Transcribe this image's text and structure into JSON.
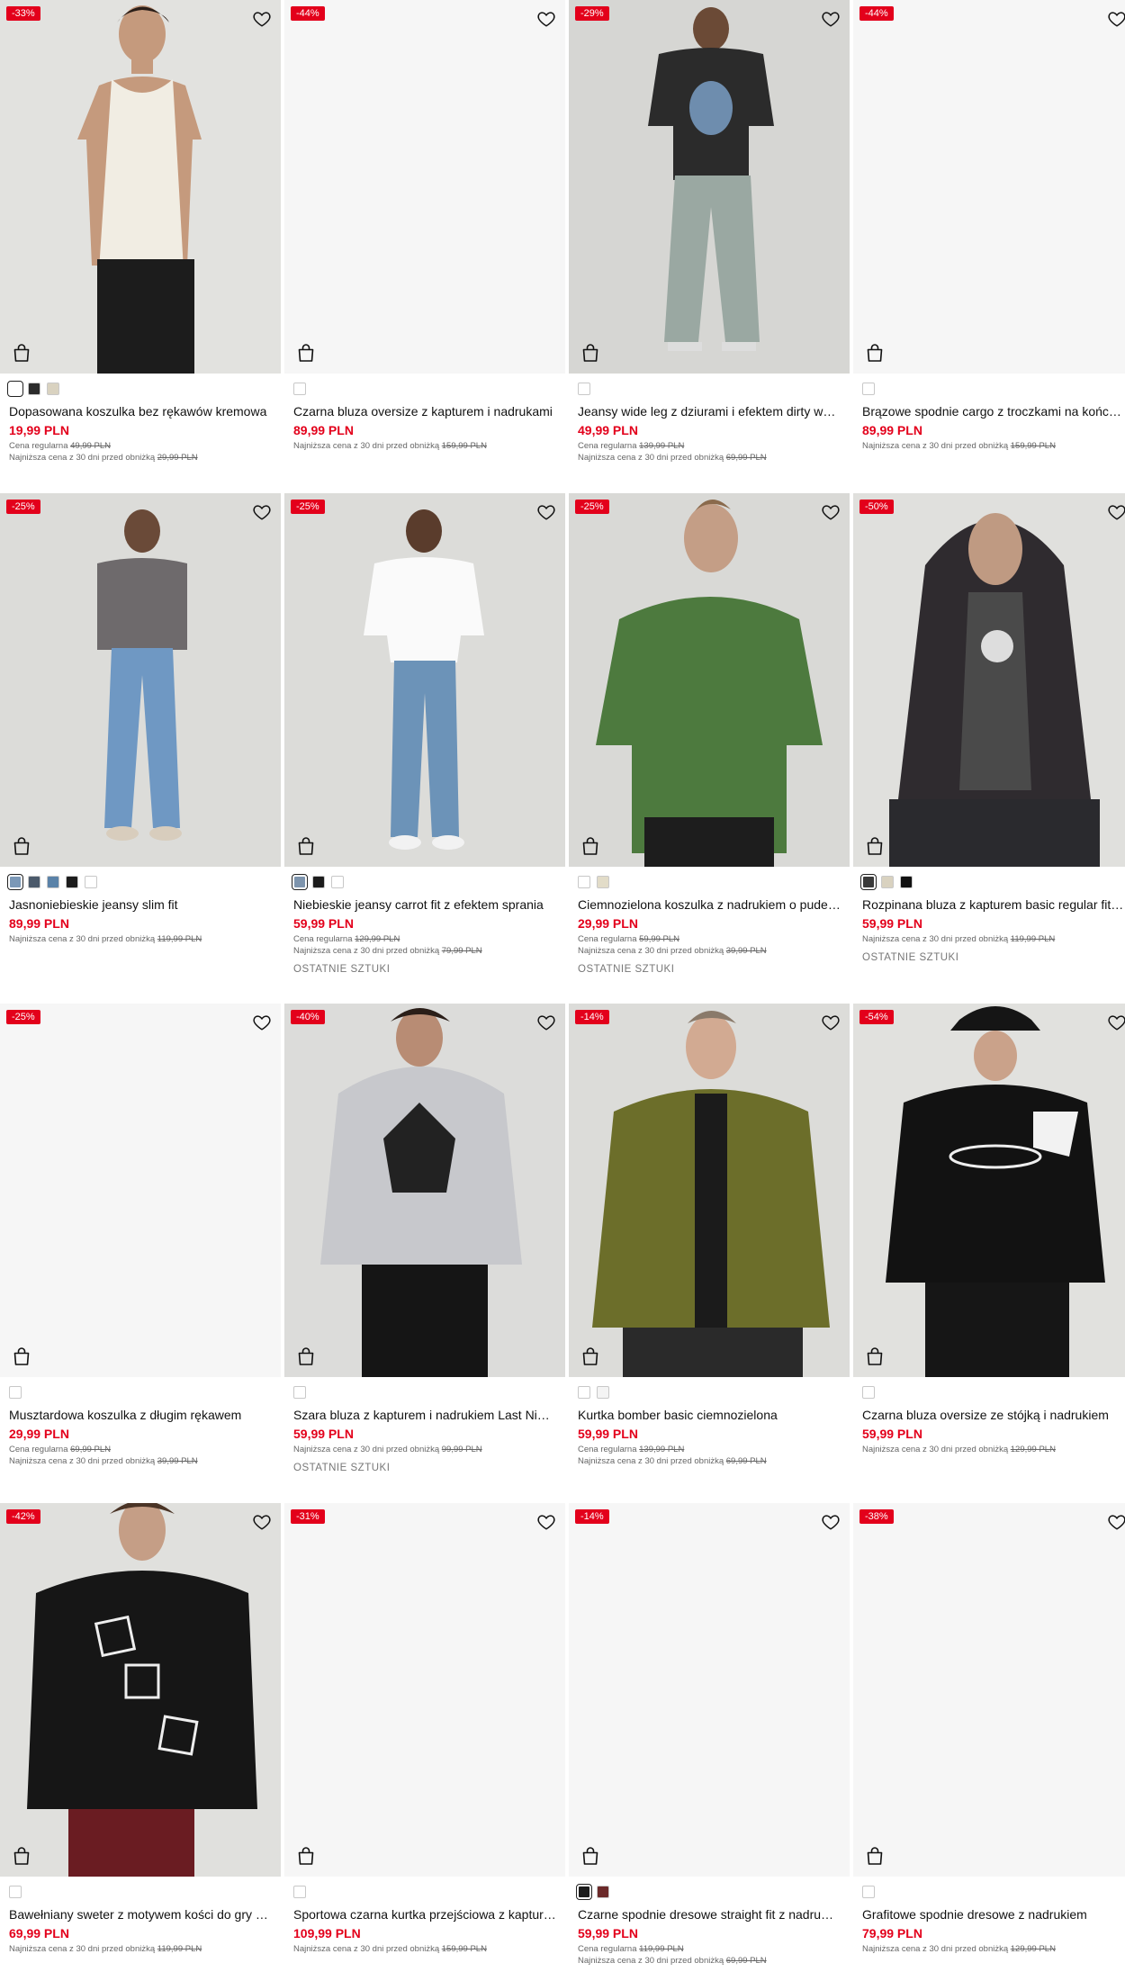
{
  "labels": {
    "regular": "Cena regularna",
    "lowest": "Najniższa cena z 30 dni przed obniżką"
  },
  "colors": {
    "accent": "#e3001b"
  },
  "products": [
    {
      "badge": "-33%",
      "name": "Dopasowana koszulka bez rękawów kremowa",
      "price": "19,99 PLN",
      "regular": "49,99 PLN",
      "lowest": "29,99 PLN",
      "last": "",
      "swatches": [
        "#ffffff",
        "#2b2b2b",
        "#d9d2c0"
      ],
      "selected": 0,
      "icons": [
        "heart-icon",
        "shopping-bag-icon"
      ],
      "photo": "tank"
    },
    {
      "badge": "-44%",
      "name": "Czarna bluza oversize z kapturem i nadrukami",
      "price": "89,99 PLN",
      "regular": "",
      "lowest": "159,99 PLN",
      "last": "",
      "swatches": [
        "#ffffff"
      ],
      "selected": -1,
      "icons": [
        "heart-icon",
        "shopping-bag-icon"
      ],
      "photo": "none"
    },
    {
      "badge": "-29%",
      "name": "Jeansy wide leg z dziurami i efektem dirty w…",
      "price": "49,99 PLN",
      "regular": "139,99 PLN",
      "lowest": "69,99 PLN",
      "last": "",
      "swatches": [
        "#ffffff"
      ],
      "selected": -1,
      "icons": [
        "heart-icon",
        "shopping-bag-icon"
      ],
      "photo": "jeans-wide"
    },
    {
      "badge": "-44%",
      "name": "Brązowe spodnie cargo z troczkami na końc…",
      "price": "89,99 PLN",
      "regular": "",
      "lowest": "159,99 PLN",
      "last": "",
      "swatches": [
        "#ffffff"
      ],
      "selected": -1,
      "icons": [
        "heart-icon",
        "shopping-bag-icon"
      ],
      "photo": "none"
    },
    {
      "badge": "-25%",
      "name": "Jasnoniebieskie jeansy slim fit",
      "price": "89,99 PLN",
      "regular": "",
      "lowest": "119,99 PLN",
      "last": "",
      "swatches": [
        "#7b98b7",
        "#4b5a6b",
        "#5a82a8",
        "#1c1c1c",
        "#ffffff"
      ],
      "selected": 0,
      "icons": [
        "heart-icon",
        "shopping-bag-icon"
      ],
      "photo": "slim"
    },
    {
      "badge": "-25%",
      "name": "Niebieskie jeansy carrot fit z efektem sprania",
      "price": "59,99 PLN",
      "regular": "129,99 PLN",
      "lowest": "79,99 PLN",
      "last": "OSTATNIE SZTUKI",
      "swatches": [
        "#7d94ad",
        "#1c1c1c",
        "#ffffff"
      ],
      "selected": 0,
      "icons": [
        "heart-icon",
        "shopping-bag-icon"
      ],
      "photo": "carrot"
    },
    {
      "badge": "-25%",
      "name": "Ciemnozielona koszulka z nadrukiem o pude…",
      "price": "29,99 PLN",
      "regular": "59,99 PLN",
      "lowest": "39,99 PLN",
      "last": "OSTATNIE SZTUKI",
      "swatches": [
        "#ffffff",
        "#e2dcc8"
      ],
      "selected": -1,
      "icons": [
        "heart-icon",
        "shopping-bag-icon"
      ],
      "photo": "greentee"
    },
    {
      "badge": "-50%",
      "name": "Rozpinana bluza z kapturem basic regular fit…",
      "price": "59,99 PLN",
      "regular": "",
      "lowest": "119,99 PLN",
      "last": "OSTATNIE SZTUKI",
      "swatches": [
        "#3a3a3a",
        "#d9d2c0",
        "#111111"
      ],
      "selected": 0,
      "icons": [
        "heart-icon",
        "shopping-bag-icon"
      ],
      "photo": "zip"
    },
    {
      "badge": "-25%",
      "name": "Musztardowa koszulka z długim rękawem",
      "price": "29,99 PLN",
      "regular": "69,99 PLN",
      "lowest": "39,99 PLN",
      "last": "",
      "swatches": [
        "#ffffff"
      ],
      "selected": -1,
      "icons": [
        "heart-icon",
        "shopping-bag-icon"
      ],
      "photo": "none"
    },
    {
      "badge": "-40%",
      "name": "Szara bluza z kapturem i nadrukiem Last Nig…",
      "price": "59,99 PLN",
      "regular": "",
      "lowest": "99,99 PLN",
      "last": "OSTATNIE SZTUKI",
      "swatches": [
        "#ffffff"
      ],
      "selected": -1,
      "icons": [
        "heart-icon",
        "shopping-bag-icon"
      ],
      "photo": "greyhood"
    },
    {
      "badge": "-14%",
      "name": "Kurtka bomber basic ciemnozielona",
      "price": "59,99 PLN",
      "regular": "139,99 PLN",
      "lowest": "69,99 PLN",
      "last": "",
      "swatches": [
        "#ffffff",
        "#f4f4f4"
      ],
      "selected": -1,
      "icons": [
        "heart-icon",
        "shopping-bag-icon"
      ],
      "photo": "bomber"
    },
    {
      "badge": "-54%",
      "name": "Czarna bluza oversize ze stójką i nadrukiem",
      "price": "59,99 PLN",
      "regular": "",
      "lowest": "129,99 PLN",
      "last": "",
      "swatches": [
        "#ffffff"
      ],
      "selected": -1,
      "icons": [
        "heart-icon",
        "shopping-bag-icon"
      ],
      "photo": "sonic"
    },
    {
      "badge": "-42%",
      "name": "Bawełniany sweter z motywem kości do gry …",
      "price": "69,99 PLN",
      "regular": "",
      "lowest": "119,99 PLN",
      "last": "",
      "swatches": [
        "#ffffff"
      ],
      "selected": -1,
      "icons": [
        "heart-icon",
        "shopping-bag-icon"
      ],
      "photo": "dice"
    },
    {
      "badge": "-31%",
      "name": "Sportowa czarna kurtka przejściowa z kaptur…",
      "price": "109,99 PLN",
      "regular": "",
      "lowest": "159,99 PLN",
      "last": "",
      "swatches": [
        "#ffffff"
      ],
      "selected": -1,
      "icons": [
        "heart-icon",
        "shopping-bag-icon"
      ],
      "photo": "none"
    },
    {
      "badge": "-14%",
      "name": "Czarne spodnie dresowe straight fit z nadru…",
      "price": "59,99 PLN",
      "regular": "119,99 PLN",
      "lowest": "69,99 PLN",
      "last": "",
      "swatches": [
        "#1c1c1c",
        "#6b2a2a"
      ],
      "selected": 0,
      "icons": [
        "heart-icon",
        "shopping-bag-icon"
      ],
      "photo": "none"
    },
    {
      "badge": "-38%",
      "name": "Grafitowe spodnie dresowe z nadrukiem",
      "price": "79,99 PLN",
      "regular": "",
      "lowest": "129,99 PLN",
      "last": "",
      "swatches": [
        "#ffffff"
      ],
      "selected": -1,
      "icons": [
        "heart-icon",
        "shopping-bag-icon"
      ],
      "photo": "none"
    }
  ]
}
